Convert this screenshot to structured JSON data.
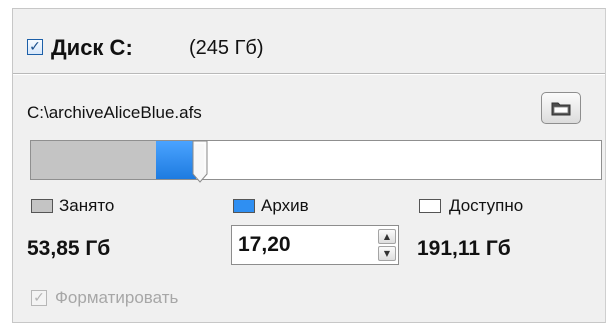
{
  "disk": {
    "enabled": true,
    "name": "Диск С:",
    "size": "(245 Гб)"
  },
  "archive_path": "C:\\archiveAliceBlue.afs",
  "folder_button": {
    "icon": "folder-icon"
  },
  "usage": {
    "used_fraction": 0.22,
    "archive_fraction": 0.07
  },
  "legend": {
    "used": {
      "label": "Занято",
      "color": "#c4c4c4"
    },
    "archive": {
      "label": "Архив",
      "color": "#2f8ff2"
    },
    "free": {
      "label": "Доступно",
      "color": "#ffffff"
    }
  },
  "values": {
    "used": "53,85 Гб",
    "archive": "17,20",
    "free": "191,11 Гб"
  },
  "format": {
    "checked": true,
    "enabled": false,
    "label": "Форматировать"
  }
}
